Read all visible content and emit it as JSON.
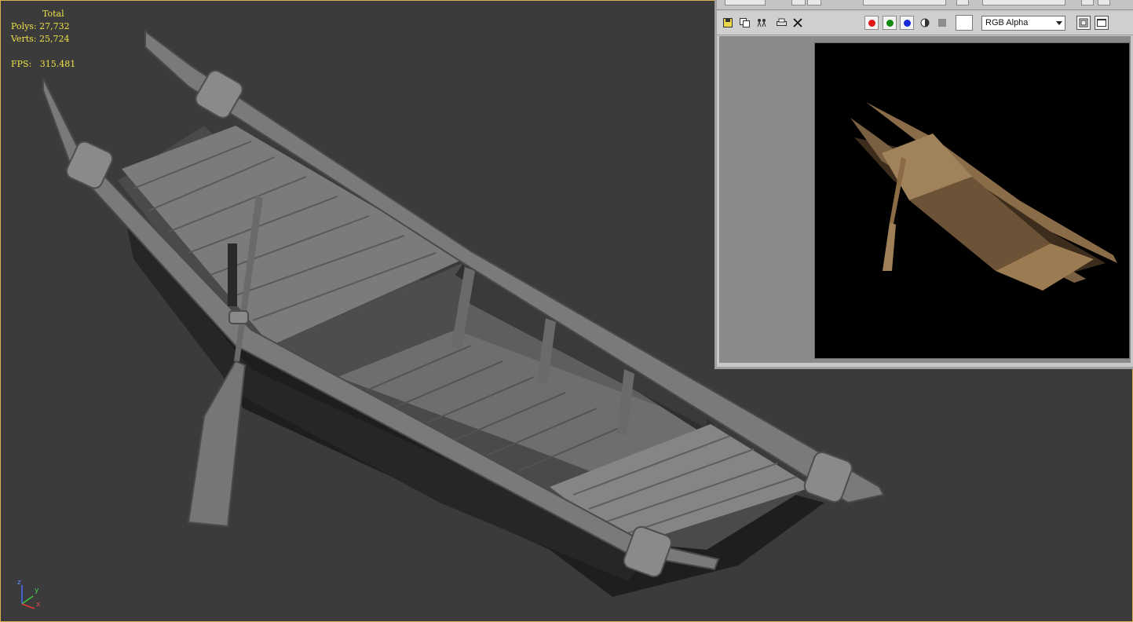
{
  "viewport": {
    "stats": {
      "total_label": "Total",
      "polys_label": "Polys:",
      "polys_value": "27,732",
      "verts_label": "Verts:",
      "verts_value": "25,724",
      "fps_label": "FPS:",
      "fps_value": "315.481"
    },
    "gizmo": {
      "z": "z",
      "y": "y",
      "x": "x"
    }
  },
  "render_window": {
    "toolbar": {
      "icons": [
        "save-icon",
        "copy-icon",
        "clone-icon",
        "print-icon",
        "clear-icon"
      ],
      "channels": {
        "red": "#e01818",
        "green": "#128a12",
        "blue": "#1a2ad8"
      },
      "display_channel": "RGB Alpha"
    },
    "accent_colors": {
      "background": "#3b3b3b",
      "stats_text": "#f0e24a",
      "viewport_border": "#d8b24a"
    }
  }
}
